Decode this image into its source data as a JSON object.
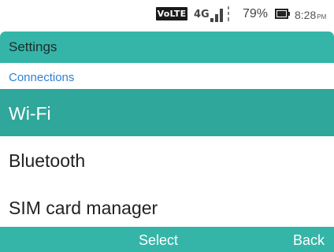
{
  "status_bar": {
    "volte": "VoLTE",
    "network": "4G",
    "signal_icon": "signal-icon",
    "battery_percent": "79%",
    "battery_icon": "battery-icon",
    "time": "8:28",
    "ampm": "PM"
  },
  "header": {
    "title": "Settings"
  },
  "section": {
    "title": "Connections"
  },
  "list": {
    "items": [
      {
        "label": "Wi-Fi",
        "selected": true
      },
      {
        "label": "Bluetooth",
        "selected": false
      },
      {
        "label": "SIM card manager",
        "selected": false
      }
    ]
  },
  "softkeys": {
    "center": "Select",
    "right": "Back"
  },
  "colors": {
    "accent": "#35b5a8",
    "selected_row": "#2fa79a",
    "section_header": "#2f7fd6"
  }
}
